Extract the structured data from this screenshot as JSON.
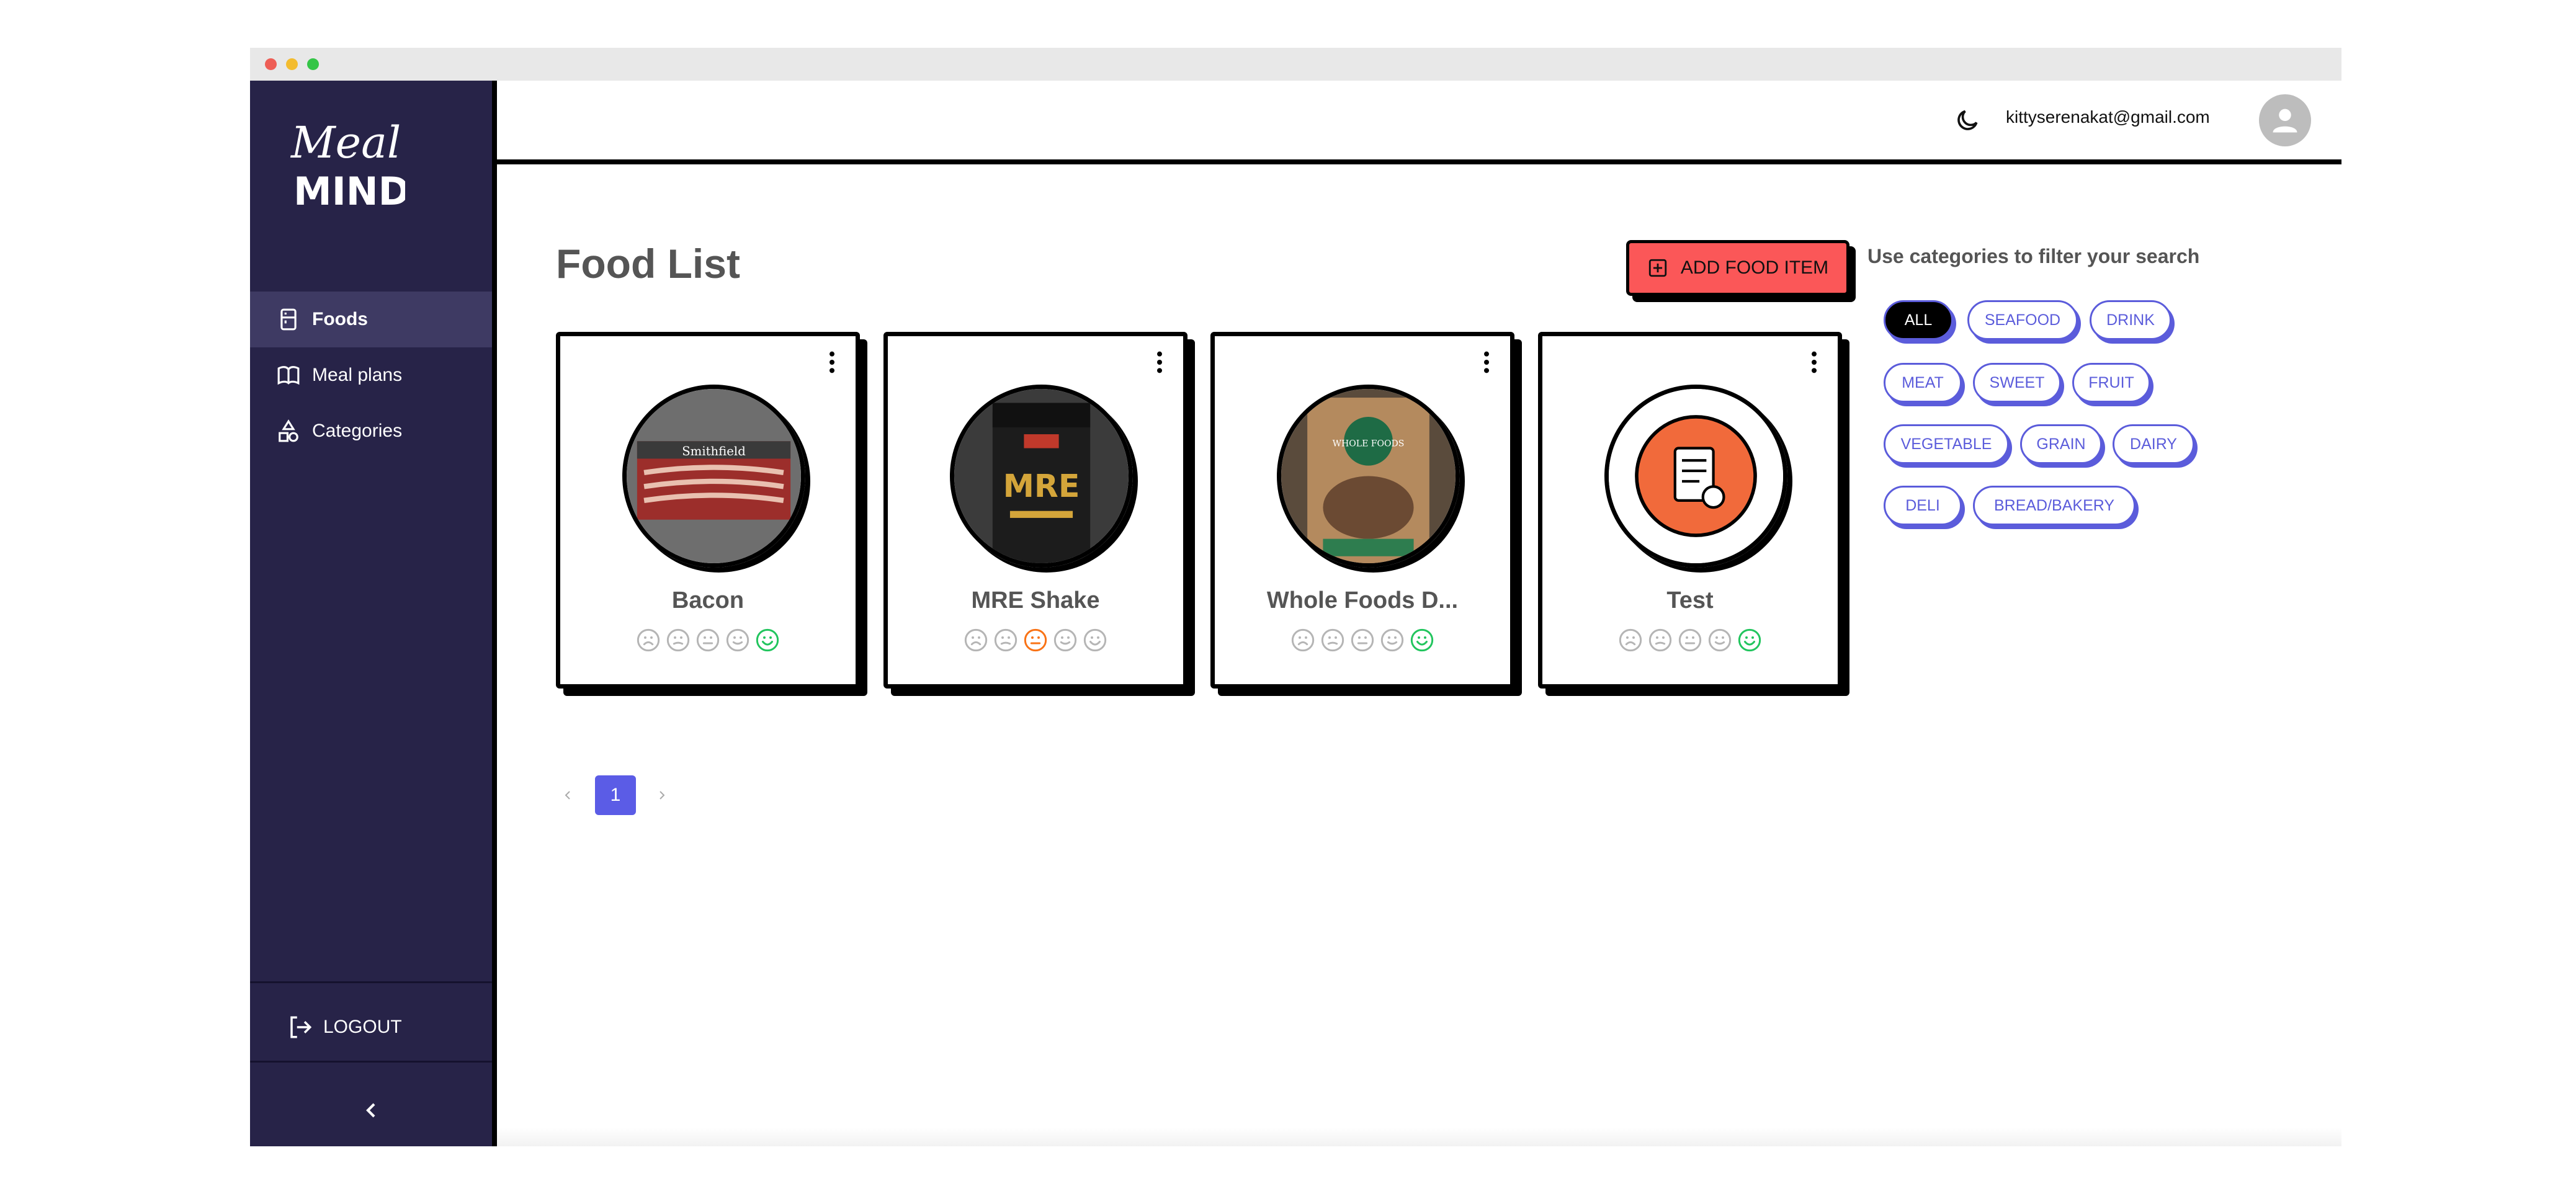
{
  "app": {
    "logo_text_top": "Meal",
    "logo_text_bottom": "MIND"
  },
  "sidebar": {
    "items": [
      {
        "label": "Foods",
        "icon": "fridge-icon",
        "active": true
      },
      {
        "label": "Meal plans",
        "icon": "book-icon",
        "active": false
      },
      {
        "label": "Categories",
        "icon": "shapes-icon",
        "active": false
      }
    ],
    "logout_label": "LOGOUT",
    "collapse_icon": "chevron-left-icon"
  },
  "header": {
    "theme_icon": "moon-icon",
    "email": "kittyserenakat@gmail.com",
    "avatar_icon": "user-avatar-icon"
  },
  "main": {
    "title": "Food List",
    "add_button_label": "ADD FOOD ITEM",
    "filter_title": "Use categories to filter your search",
    "categories": [
      "ALL",
      "SEAFOOD",
      "DRINK",
      "MEAT",
      "SWEET",
      "FRUIT",
      "VEGETABLE",
      "GRAIN",
      "DAIRY",
      "DELI",
      "BREAD/BAKERY"
    ],
    "selected_category": "ALL",
    "foods": [
      {
        "name": "Bacon",
        "rating": 5,
        "image": "bacon-photo"
      },
      {
        "name": "MRE Shake",
        "rating": 3,
        "image": "mre-shake-photo"
      },
      {
        "name": "Whole Foods D...",
        "rating": 5,
        "image": "whole-foods-photo"
      },
      {
        "name": "Test",
        "rating": 5,
        "image": "placeholder-food-icon"
      }
    ],
    "pagination": {
      "current_page": "1"
    }
  },
  "colors": {
    "sidebar_bg": "#272348",
    "accent_red": "#fb5758",
    "accent_blue": "#5b5cdb",
    "rating_green": "#22c55e",
    "rating_orange": "#f97316"
  }
}
